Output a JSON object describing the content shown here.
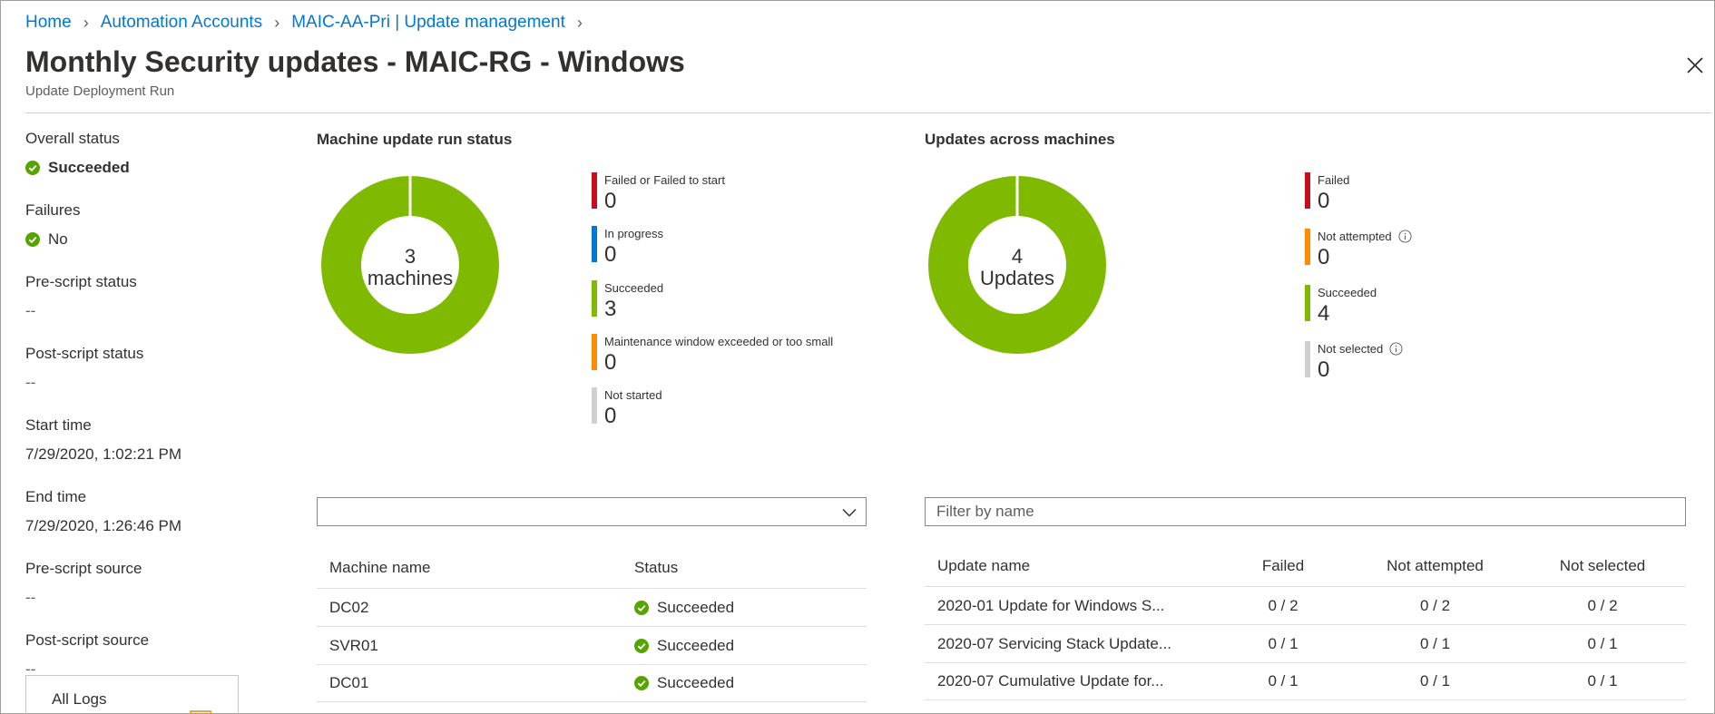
{
  "breadcrumb": [
    "Home",
    "Automation Accounts",
    "MAIC-AA-Pri | Update management"
  ],
  "page": {
    "title": "Monthly Security updates - MAIC-RG - Windows",
    "subtitle": "Update Deployment Run"
  },
  "properties": [
    {
      "label": "Overall status",
      "value": "Succeeded",
      "icon": "check-circle-icon",
      "bold": true
    },
    {
      "label": "Failures",
      "value": "No",
      "icon": "check-circle-icon",
      "bold": false
    },
    {
      "label": "Pre-script status",
      "value": "--"
    },
    {
      "label": "Post-script status",
      "value": "--"
    },
    {
      "label": "Start time",
      "value": "7/29/2020, 1:02:21 PM"
    },
    {
      "label": "End time",
      "value": "7/29/2020, 1:26:46 PM"
    },
    {
      "label": "Pre-script source",
      "value": "--"
    },
    {
      "label": "Post-script source",
      "value": "--"
    }
  ],
  "logs": {
    "label": "All Logs"
  },
  "machine_status": {
    "title": "Machine update run status",
    "donut_count": "3",
    "donut_unit": "machines",
    "donut_color": "#7fba00",
    "legend": [
      {
        "label": "Failed or Failed to start",
        "value": "0",
        "color": "#c50f1f"
      },
      {
        "label": "In progress",
        "value": "0",
        "color": "#0078d4"
      },
      {
        "label": "Succeeded",
        "value": "3",
        "color": "#7fba00"
      },
      {
        "label": "Maintenance window exceeded or too small",
        "value": "0",
        "color": "#ff8c00"
      },
      {
        "label": "Not started",
        "value": "0",
        "color": "#d2d0ce"
      }
    ]
  },
  "updates_status": {
    "title": "Updates across machines",
    "donut_count": "4",
    "donut_unit": "Updates",
    "donut_color": "#7fba00",
    "legend": [
      {
        "label": "Failed",
        "value": "0",
        "color": "#c50f1f",
        "info": false
      },
      {
        "label": "Not attempted",
        "value": "0",
        "color": "#ff8c00",
        "info": true
      },
      {
        "label": "Succeeded",
        "value": "4",
        "color": "#7fba00",
        "info": false
      },
      {
        "label": "Not selected",
        "value": "0",
        "color": "#d2d0ce",
        "info": true
      }
    ]
  },
  "machine_filter": {
    "value": ""
  },
  "update_filter": {
    "placeholder": "Filter by name"
  },
  "machines_table": {
    "headers": [
      "Machine name",
      "Status"
    ],
    "rows": [
      {
        "name": "DC02",
        "status": "Succeeded"
      },
      {
        "name": "SVR01",
        "status": "Succeeded"
      },
      {
        "name": "DC01",
        "status": "Succeeded"
      }
    ]
  },
  "updates_table": {
    "headers": [
      "Update name",
      "Failed",
      "Not attempted",
      "Not selected"
    ],
    "rows": [
      {
        "name": "2020-01 Update for Windows S...",
        "failed": "0 / 2",
        "not_attempted": "0 / 2",
        "not_selected": "0 / 2"
      },
      {
        "name": "2020-07 Servicing Stack Update...",
        "failed": "0 / 1",
        "not_attempted": "0 / 1",
        "not_selected": "0 / 1"
      },
      {
        "name": "2020-07 Cumulative Update for...",
        "failed": "0 / 1",
        "not_attempted": "0 / 1",
        "not_selected": "0 / 1"
      }
    ]
  }
}
